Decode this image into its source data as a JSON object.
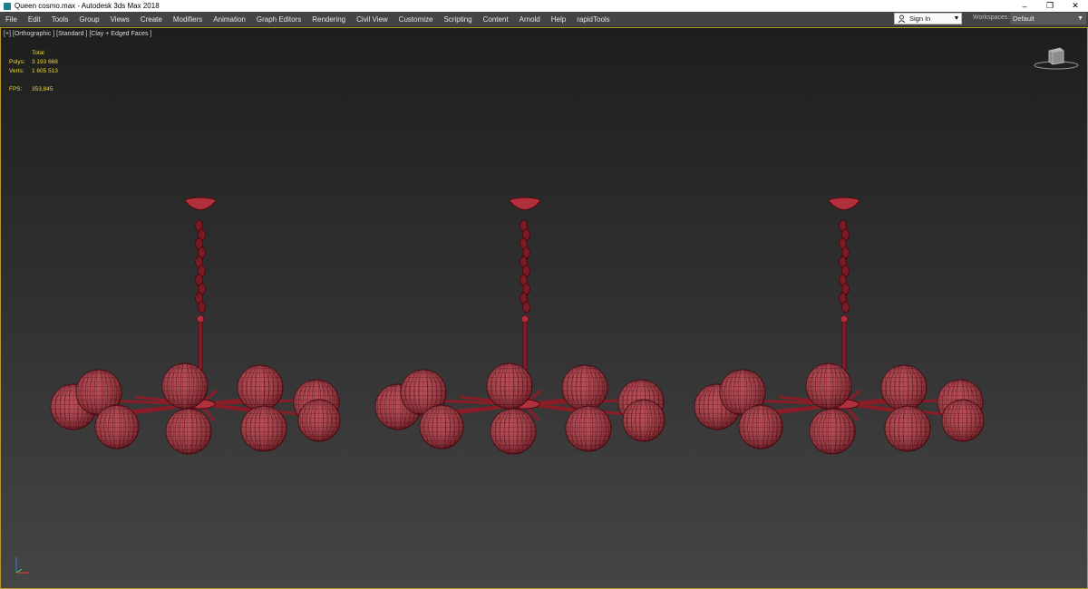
{
  "window": {
    "title": "Queen cosmo.max - Autodesk 3ds Max 2018",
    "controls": [
      "–",
      "❐",
      "✕"
    ]
  },
  "menu": {
    "items": [
      "File",
      "Edit",
      "Tools",
      "Group",
      "Views",
      "Create",
      "Modifiers",
      "Animation",
      "Graph Editors",
      "Rendering",
      "Civil View",
      "Customize",
      "Scripting",
      "Content",
      "Arnold",
      "Help",
      "rapidTools"
    ]
  },
  "account": {
    "sign_in": "Sign In"
  },
  "workspaces": {
    "label": "Workspaces:",
    "value": "Default"
  },
  "viewport": {
    "label": "[+] [Orthographic ] [Standard ] [Clay + Edged Faces ]",
    "stats": {
      "total_label": "Total",
      "polys_label": "Polys:",
      "polys_value": "3 193 668",
      "verts_label": "Verts:",
      "verts_value": "1 605 513",
      "fps_label": "FPS:",
      "fps_value": "353,845"
    },
    "model_count": 3
  },
  "colors": {
    "viewport_border": "#b79a25",
    "stats_text": "#e7d83b",
    "model_clay": "#b0303b",
    "model_wire": "#4a0a12"
  },
  "icons": [
    "app-icon",
    "user-icon",
    "dropdown-caret-icon",
    "viewcube-icon",
    "axis-tripod-icon"
  ]
}
